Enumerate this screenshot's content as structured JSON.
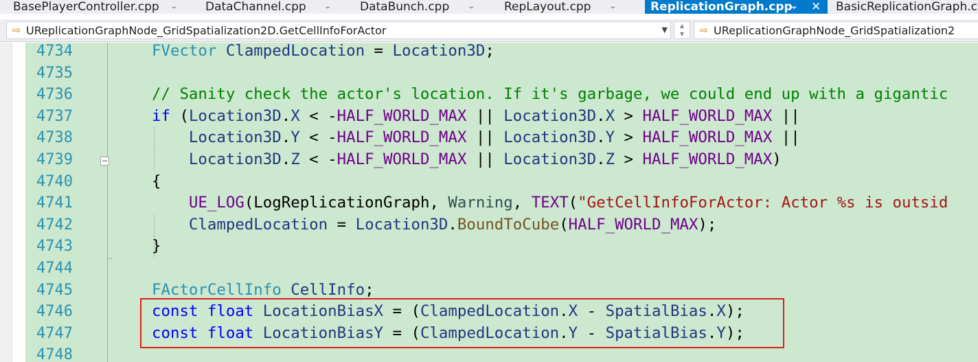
{
  "tabs": [
    {
      "label": "BasePlayerController.cpp",
      "active": false
    },
    {
      "label": "DataChannel.cpp",
      "active": false
    },
    {
      "label": "DataBunch.cpp",
      "active": false
    },
    {
      "label": "RepLayout.cpp",
      "active": false
    },
    {
      "label": "ReplicationGraph.cpp",
      "active": true
    },
    {
      "label": "BasicReplicationGraph.c",
      "active": false
    }
  ],
  "icons": {
    "pin": "pin-icon",
    "close": "close-icon",
    "member_function": "member-function-icon",
    "dropdown": "chevron-down-icon",
    "collapse": "collapse-minus-icon"
  },
  "nav": {
    "left_member": "UReplicationGraphNode_GridSpatialization2D.GetCellInfoForActor",
    "right_member": "UReplicationGraphNode_GridSpatialization2"
  },
  "colors": {
    "accent": "#007acc",
    "code_background": "#cce8cf",
    "line_number": "#2b91af",
    "highlight_box": "#e01c1c"
  },
  "code_lines": [
    {
      "num": "4734",
      "tokens": [
        [
          "FVector",
          "type"
        ],
        [
          " ",
          "plain"
        ],
        [
          "ClampedLocation",
          "var"
        ],
        [
          " = ",
          "plain"
        ],
        [
          "Location3D",
          "var"
        ],
        [
          ";",
          "plain"
        ]
      ]
    },
    {
      "num": "4735",
      "tokens": []
    },
    {
      "num": "4736",
      "tokens": [
        [
          "// Sanity check the actor's location. If it's garbage, we could end up with a gigantic",
          "comment"
        ]
      ]
    },
    {
      "num": "4737",
      "tokens": [
        [
          "if",
          "keyword"
        ],
        [
          " (",
          "plain"
        ],
        [
          "Location3D",
          "var"
        ],
        [
          ".",
          "plain"
        ],
        [
          "X",
          "member"
        ],
        [
          " < -",
          "plain"
        ],
        [
          "HALF_WORLD_MAX",
          "macro"
        ],
        [
          " || ",
          "plain"
        ],
        [
          "Location3D",
          "var"
        ],
        [
          ".",
          "plain"
        ],
        [
          "X",
          "member"
        ],
        [
          " > ",
          "plain"
        ],
        [
          "HALF_WORLD_MAX",
          "macro"
        ],
        [
          " ||",
          "plain"
        ]
      ]
    },
    {
      "num": "4738",
      "tokens": [
        [
          "    ",
          "plain"
        ],
        [
          "Location3D",
          "var"
        ],
        [
          ".",
          "plain"
        ],
        [
          "Y",
          "member"
        ],
        [
          " < -",
          "plain"
        ],
        [
          "HALF_WORLD_MAX",
          "macro"
        ],
        [
          " || ",
          "plain"
        ],
        [
          "Location3D",
          "var"
        ],
        [
          ".",
          "plain"
        ],
        [
          "Y",
          "member"
        ],
        [
          " > ",
          "plain"
        ],
        [
          "HALF_WORLD_MAX",
          "macro"
        ],
        [
          " ||",
          "plain"
        ]
      ]
    },
    {
      "num": "4739",
      "tokens": [
        [
          "    ",
          "plain"
        ],
        [
          "Location3D",
          "var"
        ],
        [
          ".",
          "plain"
        ],
        [
          "Z",
          "member"
        ],
        [
          " < -",
          "plain"
        ],
        [
          "HALF_WORLD_MAX",
          "macro"
        ],
        [
          " || ",
          "plain"
        ],
        [
          "Location3D",
          "var"
        ],
        [
          ".",
          "plain"
        ],
        [
          "Z",
          "member"
        ],
        [
          " > ",
          "plain"
        ],
        [
          "HALF_WORLD_MAX",
          "macro"
        ],
        [
          ")",
          "plain"
        ]
      ]
    },
    {
      "num": "4740",
      "tokens": [
        [
          "{",
          "plain"
        ]
      ]
    },
    {
      "num": "4741",
      "tokens": [
        [
          "    ",
          "plain"
        ],
        [
          "UE_LOG",
          "macro"
        ],
        [
          "(",
          "plain"
        ],
        [
          "LogReplicationGraph",
          "plain"
        ],
        [
          ", ",
          "plain"
        ],
        [
          "Warning",
          "enum"
        ],
        [
          ", ",
          "plain"
        ],
        [
          "TEXT",
          "macro"
        ],
        [
          "(",
          "plain"
        ],
        [
          "\"GetCellInfoForActor: Actor %s is outsid",
          "string"
        ]
      ]
    },
    {
      "num": "4742",
      "tokens": [
        [
          "    ",
          "plain"
        ],
        [
          "ClampedLocation",
          "var"
        ],
        [
          " = ",
          "plain"
        ],
        [
          "Location3D",
          "var"
        ],
        [
          ".",
          "plain"
        ],
        [
          "BoundToCube",
          "func"
        ],
        [
          "(",
          "plain"
        ],
        [
          "HALF_WORLD_MAX",
          "macro"
        ],
        [
          ");",
          "plain"
        ]
      ]
    },
    {
      "num": "4743",
      "tokens": [
        [
          "}",
          "plain"
        ]
      ]
    },
    {
      "num": "4744",
      "tokens": []
    },
    {
      "num": "4745",
      "tokens": [
        [
          "FActorCellInfo",
          "type"
        ],
        [
          " ",
          "plain"
        ],
        [
          "CellInfo",
          "var"
        ],
        [
          ";",
          "plain"
        ]
      ]
    },
    {
      "num": "4746",
      "tokens": [
        [
          "const",
          "keyword"
        ],
        [
          " ",
          "plain"
        ],
        [
          "float",
          "keyword"
        ],
        [
          " ",
          "plain"
        ],
        [
          "LocationBiasX",
          "var"
        ],
        [
          " = (",
          "plain"
        ],
        [
          "ClampedLocation",
          "var"
        ],
        [
          ".",
          "plain"
        ],
        [
          "X",
          "member"
        ],
        [
          " - ",
          "plain"
        ],
        [
          "SpatialBias",
          "member"
        ],
        [
          ".",
          "plain"
        ],
        [
          "X",
          "member"
        ],
        [
          ");",
          "plain"
        ]
      ]
    },
    {
      "num": "4747",
      "tokens": [
        [
          "const",
          "keyword"
        ],
        [
          " ",
          "plain"
        ],
        [
          "float",
          "keyword"
        ],
        [
          " ",
          "plain"
        ],
        [
          "LocationBiasY",
          "var"
        ],
        [
          " = (",
          "plain"
        ],
        [
          "ClampedLocation",
          "var"
        ],
        [
          ".",
          "plain"
        ],
        [
          "Y",
          "member"
        ],
        [
          " - ",
          "plain"
        ],
        [
          "SpatialBias",
          "member"
        ],
        [
          ".",
          "plain"
        ],
        [
          "Y",
          "member"
        ],
        [
          ");",
          "plain"
        ]
      ]
    },
    {
      "num": "4748",
      "tokens": []
    }
  ]
}
